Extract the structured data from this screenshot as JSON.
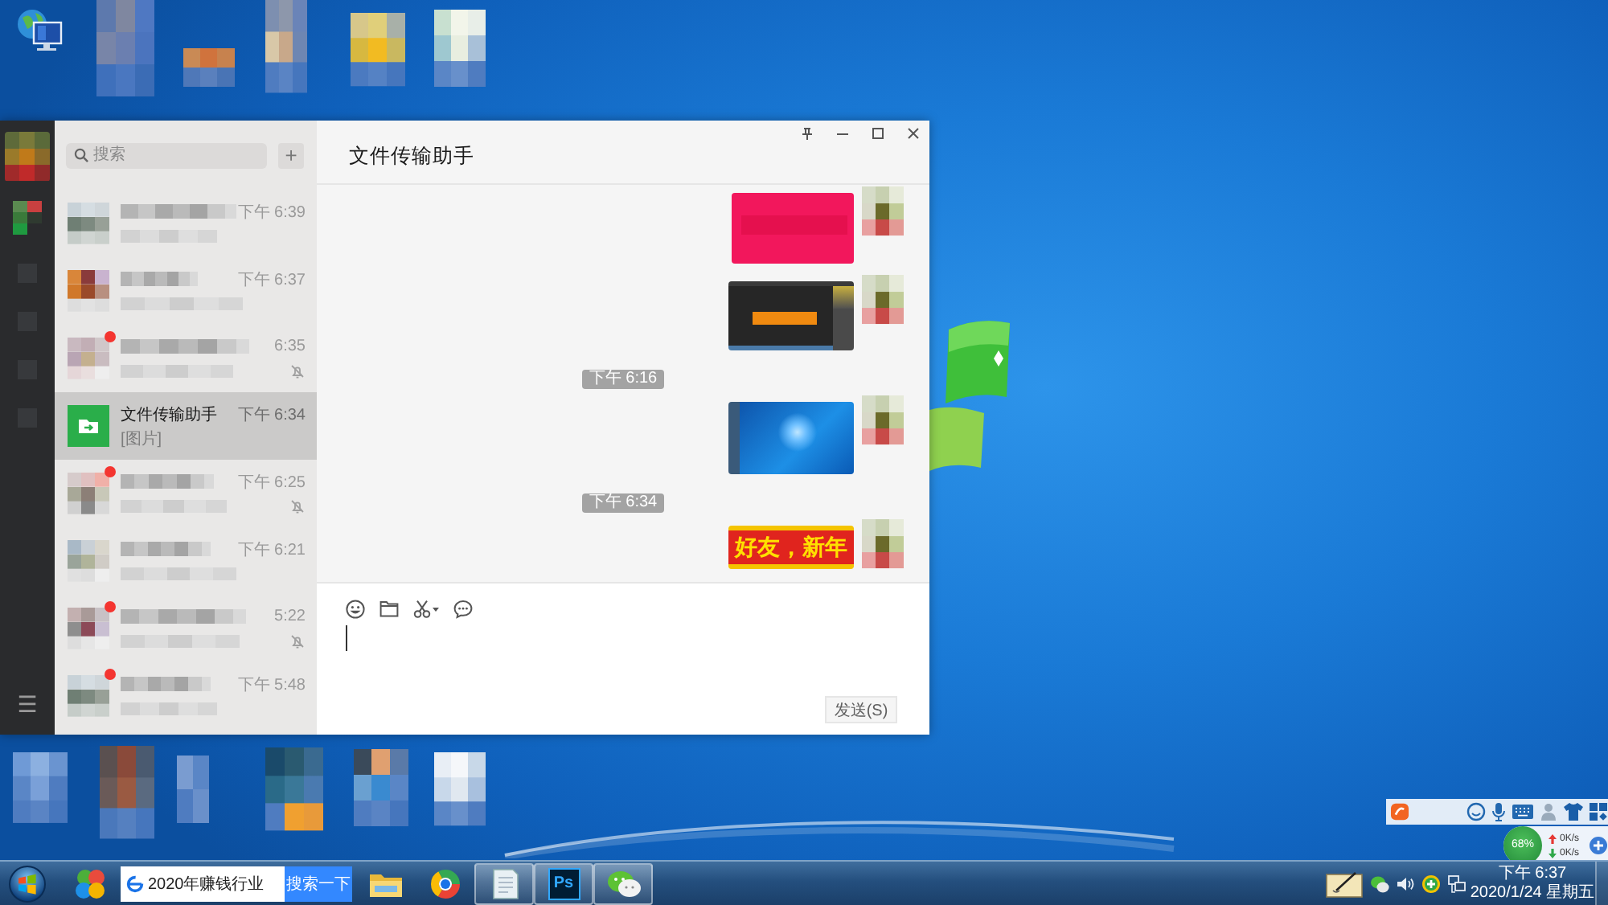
{
  "wechat": {
    "sidebar": {
      "menu_glyph": "☰"
    },
    "search": {
      "placeholder": "搜索"
    },
    "add_glyph": "+",
    "conversations": [
      {
        "kind": "pixelated",
        "time": "下午 6:39",
        "unread": false,
        "muted": false,
        "selected": false
      },
      {
        "kind": "pixelated",
        "time": "下午 6:37",
        "unread": false,
        "muted": false,
        "selected": false
      },
      {
        "kind": "pixelated",
        "time": "6:35",
        "unread": true,
        "muted": true,
        "selected": false
      },
      {
        "kind": "file_transfer",
        "name": "文件传输助手",
        "preview": "[图片]",
        "time": "下午 6:34",
        "unread": false,
        "muted": false,
        "selected": true
      },
      {
        "kind": "pixelated",
        "time": "下午 6:25",
        "unread": true,
        "muted": true,
        "selected": false
      },
      {
        "kind": "pixelated",
        "time": "下午 6:21",
        "unread": false,
        "muted": false,
        "selected": false
      },
      {
        "kind": "pixelated",
        "time": "5:22",
        "unread": true,
        "muted": true,
        "selected": false
      },
      {
        "kind": "pixelated",
        "time": "下午 5:48",
        "unread": true,
        "muted": false,
        "selected": false
      }
    ],
    "chat": {
      "title": "文件传输助手",
      "messages": [
        {
          "kind": "card"
        },
        {
          "kind": "editor"
        },
        {
          "kind": "time",
          "text": "下午 6:16"
        },
        {
          "kind": "desktop"
        },
        {
          "kind": "time",
          "text": "下午 6:34"
        },
        {
          "kind": "banner",
          "text": "好友，新年"
        }
      ],
      "send_button": "发送(S)"
    }
  },
  "taskbar": {
    "search": {
      "value": "2020年赚钱行业"
    },
    "search_button": "搜索一下",
    "apps": [
      {
        "kind": "folder",
        "running": false
      },
      {
        "kind": "ring",
        "running": false
      },
      {
        "kind": "notepad",
        "running": true
      },
      {
        "kind": "tile",
        "label": "Ps",
        "running": true
      },
      {
        "kind": "chat",
        "running": true
      }
    ],
    "clock": {
      "time": "下午 6:37",
      "date": "2020/1/24 星期五"
    }
  },
  "widgets": {
    "memory": "68%",
    "upload": "0K/s",
    "download": "0K/s"
  }
}
